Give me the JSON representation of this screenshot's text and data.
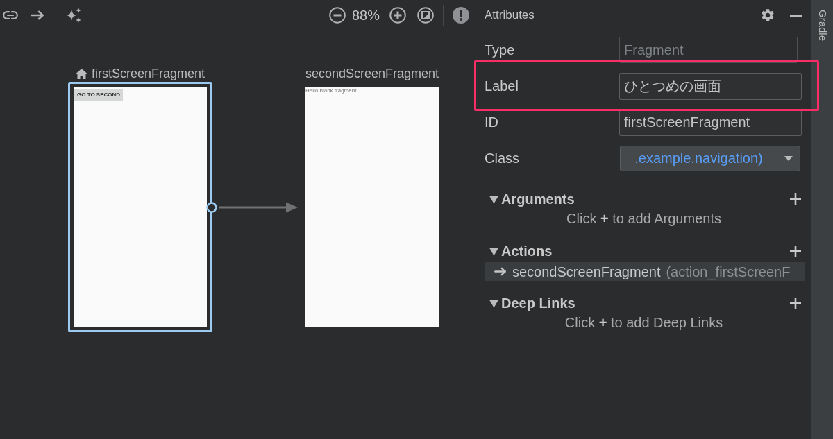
{
  "canvas_toolbar": {
    "zoom": "88%"
  },
  "canvas": {
    "destinations": [
      {
        "label": "firstScreenFragment",
        "start": true,
        "selected": true,
        "screen": {
          "kind": "button",
          "text": "GO TO SECOND"
        }
      },
      {
        "label": "secondScreenFragment",
        "start": false,
        "selected": false,
        "screen": {
          "kind": "text",
          "text": "Hello blank fragment"
        }
      }
    ]
  },
  "attributes_panel": {
    "title": "Attributes",
    "fields": [
      {
        "label": "Type",
        "kind": "text",
        "value": "Fragment",
        "disabled": true,
        "highlighted": false
      },
      {
        "label": "Label",
        "kind": "text",
        "value": "ひとつめの画面",
        "disabled": false,
        "highlighted": true
      },
      {
        "label": "ID",
        "kind": "text",
        "value": "firstScreenFragment",
        "disabled": false,
        "highlighted": false
      },
      {
        "label": "Class",
        "kind": "dropdown",
        "value": ".example.navigation)",
        "disabled": false,
        "highlighted": false
      }
    ],
    "sections": [
      {
        "title": "Arguments",
        "expanded": true,
        "hint": "Click **+** to add Arguments"
      },
      {
        "title": "Actions",
        "expanded": true,
        "actions": [
          {
            "destination": "secondScreenFragment",
            "action_name": "(action_firstScreenF"
          }
        ]
      },
      {
        "title": "Deep Links",
        "expanded": true,
        "hint": "Click **+** to add Deep Links"
      }
    ]
  },
  "side_tab": "Gradle"
}
